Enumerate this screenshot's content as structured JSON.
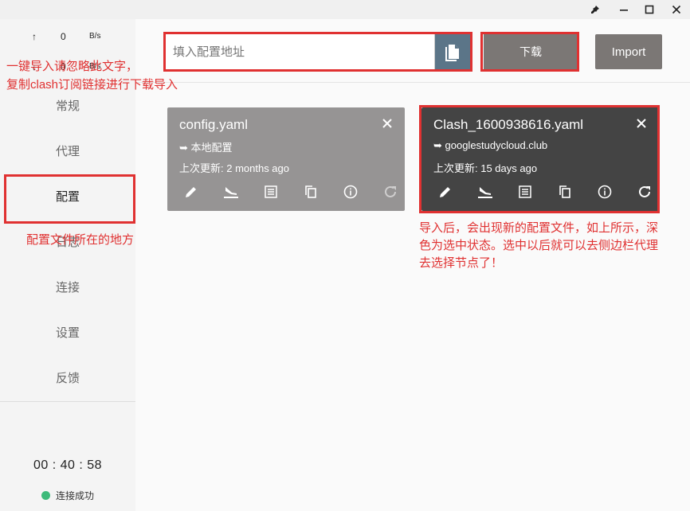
{
  "window": {
    "pin_icon": "pin-icon",
    "minimize_icon": "minimize-icon",
    "maximize_icon": "maximize-icon",
    "close_icon": "close-icon"
  },
  "sidebar": {
    "traffic": [
      {
        "arrow": "↑",
        "value": "0",
        "unit": "B/s"
      },
      {
        "arrow": "↓",
        "value": "0",
        "unit": "B/s"
      }
    ],
    "nav": [
      {
        "label": "常规"
      },
      {
        "label": "代理"
      },
      {
        "label": "配置"
      },
      {
        "label": "日志"
      },
      {
        "label": "连接"
      },
      {
        "label": "设置"
      },
      {
        "label": "反馈"
      }
    ],
    "timer": "00 : 40 : 58",
    "status_text": "连接成功",
    "status_color": "#3dba7a"
  },
  "toolbar": {
    "url_placeholder": "填入配置地址",
    "url_value": "",
    "download_label": "下载",
    "import_label": "Import"
  },
  "profiles": [
    {
      "name": "config.yaml",
      "source": "➥ 本地配置",
      "updated": "上次更新: 2 months ago",
      "selected": false
    },
    {
      "name": "Clash_1600938616.yaml",
      "source": "➥ googlestudycloud.club",
      "updated": "上次更新: 15 days ago",
      "selected": true
    }
  ],
  "annotations": {
    "import_note": "一键导入请忽略此文字，\n复制clash订阅链接进行下载导入",
    "config_note": "配置文件所在的地方",
    "selected_note": "导入后，会出现新的配置文件，如上所示，深\n色为选中状态。选中以后就可以去侧边栏代理\n去选择节点了！",
    "color": "#e03131"
  }
}
